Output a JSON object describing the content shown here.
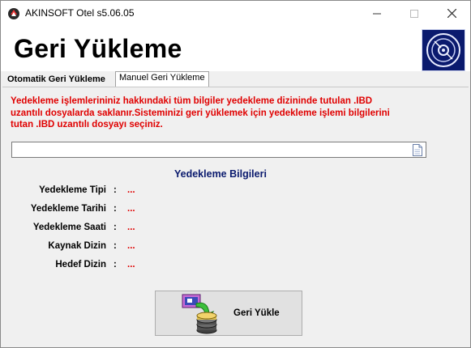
{
  "window": {
    "title": "AKINSOFT Otel s5.06.05",
    "icon": "akinsoft-app-icon",
    "controls": [
      "minimize",
      "maximize",
      "close"
    ]
  },
  "header": {
    "title": "Geri Yükleme",
    "logo": "disc-icon"
  },
  "tabs": [
    {
      "label": "Otomatik Geri Yükleme",
      "active": false
    },
    {
      "label": "Manuel Geri Yükleme",
      "active": true
    }
  ],
  "main": {
    "info_text": "Yedekleme işlemlerininiz hakkındaki tüm bilgiler yedekleme dizininde tutulan .IBD uzantılı dosyalarda saklanır.Sisteminizi geri yüklemek için yedekleme işlemi bilgilerini tutan .IBD uzantılı dosyayı seçiniz.",
    "file_input": {
      "value": "",
      "icon": "file-icon"
    },
    "section_title": "Yedekleme Bilgileri",
    "rows": [
      {
        "label": "Yedekleme Tipi",
        "colon": ":",
        "value": "..."
      },
      {
        "label": "Yedekleme Tarihi",
        "colon": ":",
        "value": "..."
      },
      {
        "label": "Yedekleme Saati",
        "colon": ":",
        "value": "..."
      },
      {
        "label": "Kaynak Dizin",
        "colon": ":",
        "value": "..."
      },
      {
        "label": "Hedef Dizin",
        "colon": ":",
        "value": "..."
      }
    ],
    "restore_button": {
      "label": "Geri Yükle",
      "icon": "restore-database-icon"
    }
  },
  "colors": {
    "accent": "#0a1a6e",
    "warning_text": "#e00000",
    "window_bg": "#f0f0f0"
  }
}
